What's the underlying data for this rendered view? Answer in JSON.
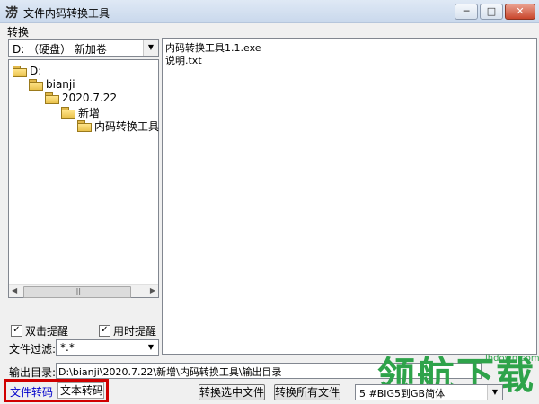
{
  "window": {
    "title": "文件内码转换工具",
    "icon_char": "涝"
  },
  "menu": {
    "items": [
      "转换"
    ]
  },
  "drive_select": {
    "value": "D:  （硬盘）  新加卷"
  },
  "tree": {
    "nodes": [
      "D:",
      "bianji",
      "2020.7.22",
      "新增",
      "内码转换工具"
    ]
  },
  "files": [
    "内码转换工具1.1.exe",
    "说明.txt"
  ],
  "options": {
    "double_click_label": "双击提醒",
    "double_click_checked": "✓",
    "realtime_label": "用时提醒",
    "realtime_checked": "✓"
  },
  "filter": {
    "label": "文件过滤:",
    "value": "*.*"
  },
  "output": {
    "label": "输出目录:",
    "value": "D:\\bianji\\2020.7.22\\新增\\内码转换工具\\输出目录"
  },
  "tabs": {
    "file_label": "文件转码",
    "text_label": "文本转码"
  },
  "buttons": {
    "convert_selected": "转换选中文件",
    "convert_all": "转换所有文件"
  },
  "encoding": {
    "value": "5 #BIG5到GB简体"
  },
  "watermark": {
    "text": "领航下载",
    "url": "lhdown.com"
  },
  "colors": {
    "active_tab": "#0000cc",
    "highlight_border": "#d00000",
    "watermark": "#2ea34a"
  }
}
